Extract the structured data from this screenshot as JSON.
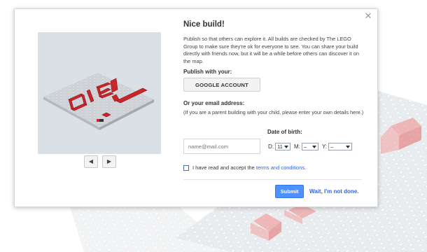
{
  "modal": {
    "title": "Nice build!",
    "description": "Publish so that others can explore it. All builds are checked by The LEGO Group to make sure they're ok for everyone to see. You can share your build directly with friends now, but it will be a while before others can discover it on the map.",
    "publish_label": "Publish with your:",
    "google_button": "GOOGLE ACCOUNT",
    "email_label": "Or your email address:",
    "parent_note": "(If you are a parent building with your child, please enter your own details here.)",
    "email_placeholder": "name@mail.com",
    "dob_label": "Date of birth:",
    "dob": {
      "day_label": "D:",
      "day_value": "11",
      "month_label": "M:",
      "month_value": "–",
      "year_label": "Y:",
      "year_value": "–"
    },
    "terms_prefix": "I have read and accept the ",
    "terms_link": "terms and conditions",
    "terms_suffix": ".",
    "submit": "Submit",
    "not_done": "Wait, I'm not done.",
    "close_icon": "close-icon",
    "prev_icon": "◀",
    "next_icon": "▶"
  },
  "colors": {
    "accent": "#4d90fe",
    "link": "#3366cc",
    "brick_red": "#c8262b",
    "plate_grey": "#c9cdd1"
  }
}
